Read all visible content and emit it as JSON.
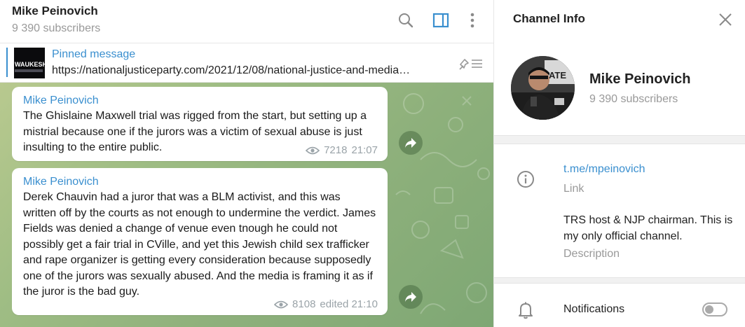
{
  "chat": {
    "title": "Mike Peinovich",
    "subtitle": "9 390 subscribers",
    "icons": {
      "search": "search-icon",
      "side_panel": "side-panel-icon",
      "more": "more-vertical-icon"
    }
  },
  "pinned": {
    "label": "Pinned message",
    "text": "https://nationaljusticeparty.com/2021/12/08/national-justice-and-media…",
    "thumb_text": "WAUKESHA"
  },
  "messages": [
    {
      "sender": "Mike Peinovich",
      "text": "The Ghislaine Maxwell trial was rigged from the start, but setting up a mistrial because one if the jurors was a victim of sexual abuse is just insulting to the entire public.",
      "views": "7218",
      "time": "21:07"
    },
    {
      "sender": "Mike Peinovich",
      "text": "Derek Chauvin had a juror that was a BLM activist, and this was written off by the courts as not enough to undermine the verdict. James Fields was denied a change of venue even tnough he could not possibly get a fair trial in CVille, and yet this Jewish child sex trafficker and rape organizer is getting every consideration because supposedly one of the jurors was sexually abused. And the media is framing it as if the juror is the bad guy.",
      "views": "8108",
      "time": "edited 21:10"
    }
  ],
  "info": {
    "title": "Channel Info",
    "name": "Mike Peinovich",
    "subscribers": "9 390 subscribers",
    "link": "t.me/mpeinovich",
    "link_label": "Link",
    "description": "TRS host & NJP chairman. This is my only official channel.",
    "description_label": "Description",
    "notifications_label": "Notifications",
    "notifications_on": false
  },
  "colors": {
    "accent": "#3a8fcf",
    "chat_bg": "#9fbd84"
  }
}
